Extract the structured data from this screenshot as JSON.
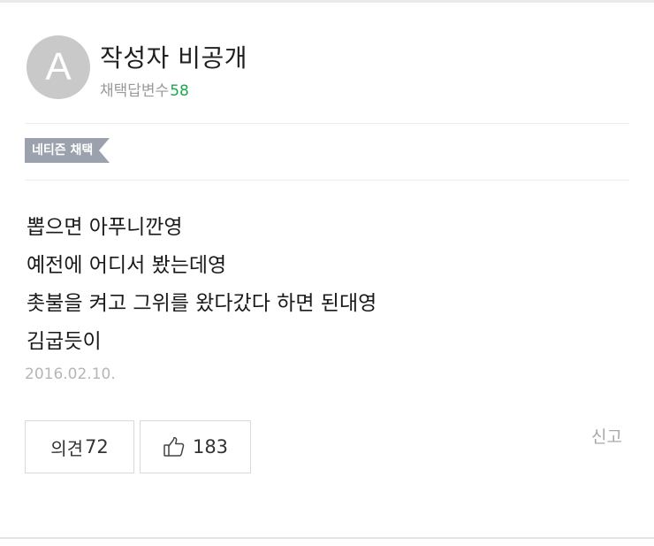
{
  "author": {
    "avatar_letter": "A",
    "name": "작성자 비공개",
    "adopt_label": "채택답변수",
    "adopt_count": "58"
  },
  "badge": {
    "label": "네티즌 채택"
  },
  "answer": {
    "lines": [
      "뽑으면 아푸니깐영",
      "예전에 어디서 봤는데영",
      "촛불을 켜고 그위를 왔다갔다 하면 된대영",
      "김굽듯이"
    ],
    "date": "2016.02.10."
  },
  "actions": {
    "opinion_label": "의견",
    "opinion_count": "72",
    "like_count": "183",
    "like_icon": "thumbs-up-icon",
    "report_label": "신고"
  },
  "colors": {
    "adopt_count": "#1aa84c",
    "badge_bg": "#9ba2ad",
    "avatar_bg": "#c9c9c9"
  }
}
